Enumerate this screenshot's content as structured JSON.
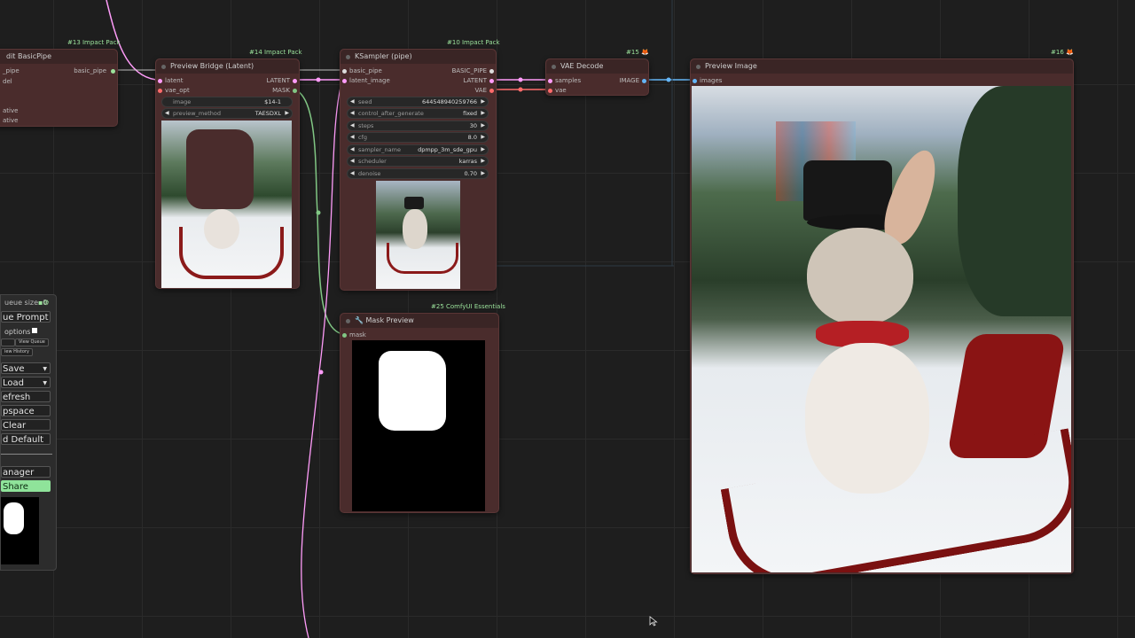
{
  "nodes": {
    "edit_basicpipe": {
      "title": "dit BasicPipe",
      "badge": "#13 Impact Pack",
      "inputs": [
        "_pipe",
        "del",
        "ative",
        "ative"
      ],
      "output": "basic_pipe"
    },
    "preview_bridge": {
      "title": "Preview Bridge (Latent)",
      "badge": "#14 Impact Pack",
      "inputs": [
        "latent",
        "vae_opt"
      ],
      "outputs": [
        "LATENT",
        "MASK"
      ],
      "widgets": [
        {
          "label": "image",
          "value": "$14-1"
        },
        {
          "label": "preview_method",
          "value": "TAESDXL"
        }
      ]
    },
    "ksampler": {
      "title": "KSampler (pipe)",
      "badge": "#10 Impact Pack",
      "inputs": [
        "basic_pipe",
        "latent_image"
      ],
      "outputs": [
        "BASIC_PIPE",
        "LATENT",
        "VAE"
      ],
      "widgets": [
        {
          "label": "seed",
          "value": "644548940259766"
        },
        {
          "label": "control_after_generate",
          "value": "fixed"
        },
        {
          "label": "steps",
          "value": "30"
        },
        {
          "label": "cfg",
          "value": "8.0"
        },
        {
          "label": "sampler_name",
          "value": "dpmpp_3m_sde_gpu"
        },
        {
          "label": "scheduler",
          "value": "karras"
        },
        {
          "label": "denoise",
          "value": "0.70"
        }
      ]
    },
    "vae_decode": {
      "title": "VAE Decode",
      "badge": "#15 🦊",
      "inputs": [
        "samples",
        "vae"
      ],
      "output": "IMAGE"
    },
    "preview_image": {
      "title": "Preview Image",
      "badge": "#16 🦊",
      "input": "images"
    },
    "mask_preview": {
      "title": "🔧 Mask Preview",
      "badge": "#25 ComfyUI Essentials",
      "input": "mask"
    }
  },
  "menu": {
    "queue_size": "ueue size: 0",
    "queue_prompt": "ue Prompt",
    "extra_options": "options",
    "view_queue": "View Queue",
    "view_history": "iew History",
    "save": "Save",
    "load": "Load",
    "refresh": "efresh",
    "clipspace": "pspace",
    "clear": "Clear",
    "load_default": "d Default",
    "manager": "anager",
    "share": "Share"
  },
  "colors": {
    "node_bg": "#4a2c2c",
    "latent_wire": "#ff9cf9",
    "mask_wire": "#81c784",
    "image_wire": "#64b5f6",
    "badge": "#9be29b"
  }
}
